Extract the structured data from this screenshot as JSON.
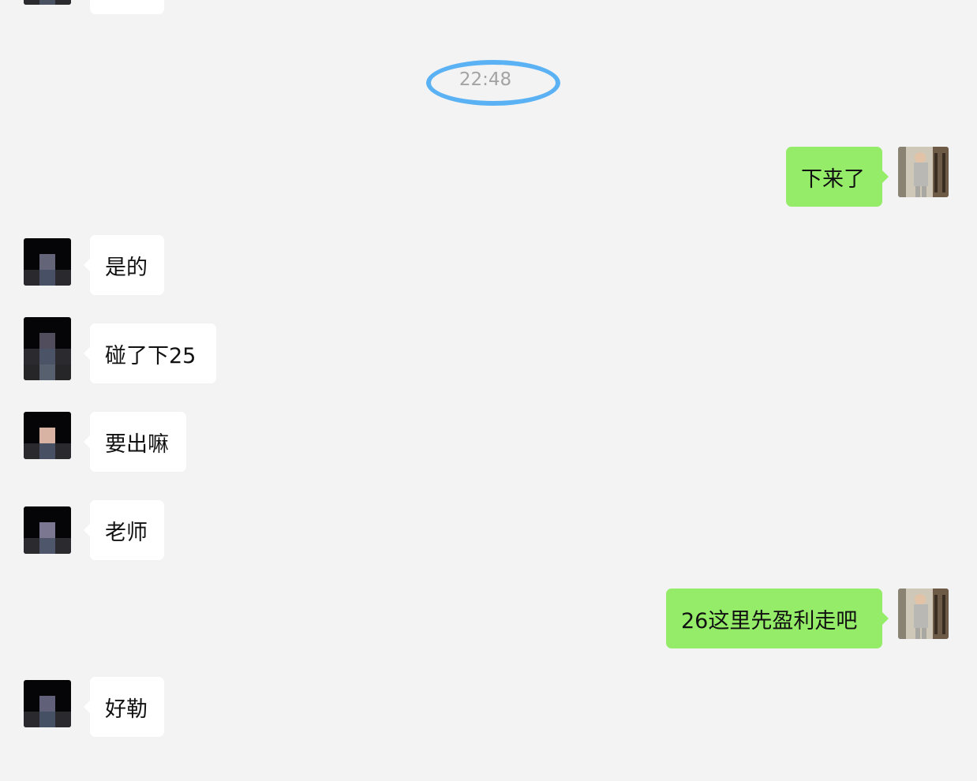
{
  "chat": {
    "timestamp": "22:48",
    "messages": [
      {
        "side": "out",
        "text": "下来了"
      },
      {
        "side": "in",
        "text": "是的"
      },
      {
        "side": "in",
        "text": "碰了下25"
      },
      {
        "side": "in",
        "text": "要出嘛"
      },
      {
        "side": "in",
        "text": "老师"
      },
      {
        "side": "out",
        "text": "26这里先盈利走吧"
      },
      {
        "side": "in",
        "text": "好勒"
      }
    ]
  },
  "colors": {
    "background": "#f3f3f3",
    "incoming_bubble": "#ffffff",
    "outgoing_bubble": "#95ec69",
    "timestamp_text": "#a3a3a3",
    "highlight_ring": "#5ab2f5"
  }
}
